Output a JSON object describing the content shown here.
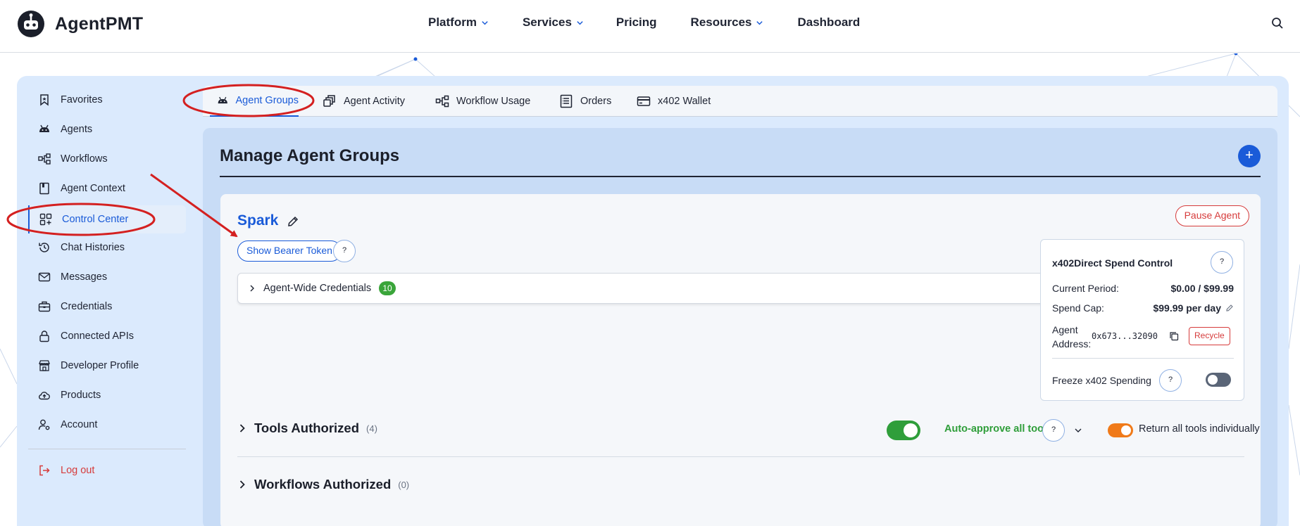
{
  "app": {
    "brand": "AgentPMT"
  },
  "nav": {
    "items": [
      {
        "label": "Platform",
        "has_dropdown": true
      },
      {
        "label": "Services",
        "has_dropdown": true
      },
      {
        "label": "Pricing",
        "has_dropdown": false
      },
      {
        "label": "Resources",
        "has_dropdown": true
      },
      {
        "label": "Dashboard",
        "has_dropdown": false
      }
    ]
  },
  "sidebar": {
    "items": [
      {
        "label": "Favorites",
        "icon": "bookmark-icon"
      },
      {
        "label": "Agents",
        "icon": "robot-icon"
      },
      {
        "label": "Workflows",
        "icon": "workflow-icon"
      },
      {
        "label": "Agent Context",
        "icon": "book-icon"
      },
      {
        "label": "Control Center",
        "icon": "grid-plus-icon",
        "active": true
      },
      {
        "label": "Chat Histories",
        "icon": "history-icon"
      },
      {
        "label": "Messages",
        "icon": "mail-icon"
      },
      {
        "label": "Credentials",
        "icon": "briefcase-icon"
      },
      {
        "label": "Connected APIs",
        "icon": "lock-icon"
      },
      {
        "label": "Developer Profile",
        "icon": "storefront-icon"
      },
      {
        "label": "Products",
        "icon": "cloud-upload-icon"
      },
      {
        "label": "Account",
        "icon": "user-gear-icon"
      }
    ],
    "logout": "Log out"
  },
  "tabs": [
    {
      "label": "Agent Groups",
      "icon": "robot-icon",
      "active": true
    },
    {
      "label": "Agent Activity",
      "icon": "activity-icon"
    },
    {
      "label": "Workflow Usage",
      "icon": "workflow-icon"
    },
    {
      "label": "Orders",
      "icon": "orders-icon"
    },
    {
      "label": "x402 Wallet",
      "icon": "card-icon"
    }
  ],
  "main": {
    "title": "Manage Agent Groups",
    "add_label": "+"
  },
  "agent": {
    "name": "Spark",
    "pause_label": "Pause Agent",
    "bearer_label": "Show Bearer Token",
    "help_label": "?",
    "credentials": {
      "label": "Agent-Wide Credentials",
      "count": "10"
    },
    "spend": {
      "title": "x402Direct Spend Control",
      "current_period_label": "Current Period:",
      "current_period_value": "$0.00 / $99.99",
      "spend_cap_label": "Spend Cap:",
      "spend_cap_value": "$99.99 per day",
      "address_label": "Agent Address:",
      "address_value": "0x673...32090",
      "recycle_label": "Recycle",
      "freeze_label": "Freeze x402 Spending",
      "freeze_on": false
    },
    "tools": {
      "title": "Tools Authorized",
      "count": "(4)",
      "auto_approve_label": "Auto-approve all tools",
      "auto_approve_on": true,
      "return_label": "Return all tools individually",
      "return_on": true
    },
    "workflows": {
      "title": "Workflows Authorized",
      "count": "(0)"
    }
  },
  "colors": {
    "accent": "#1a5bd8",
    "danger": "#d63b3b",
    "success": "#2f9e3a",
    "warning": "#f07a19",
    "annotation": "#d42020"
  }
}
